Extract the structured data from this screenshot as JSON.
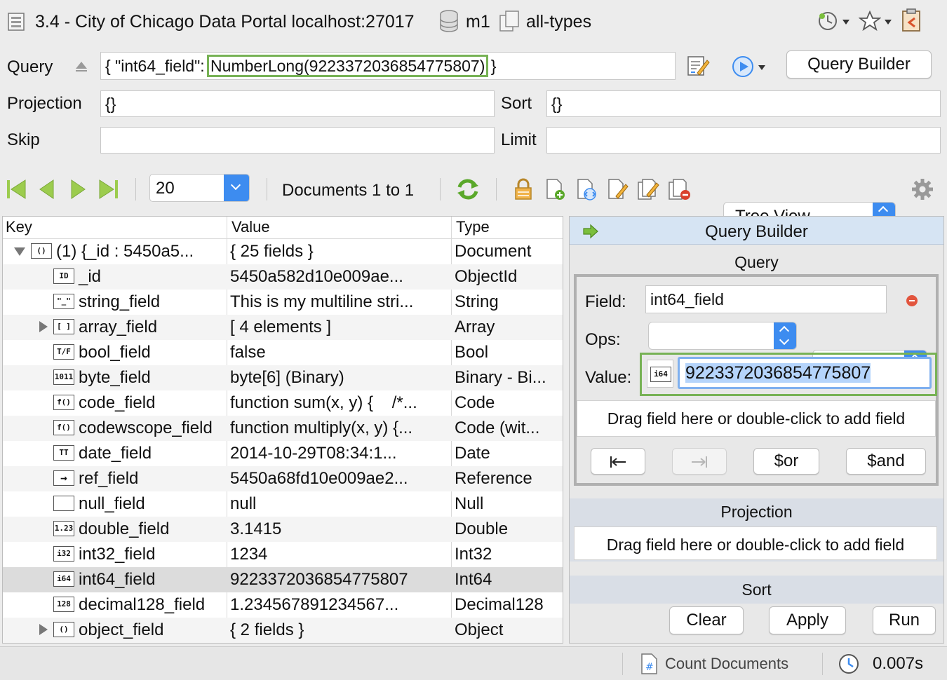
{
  "title": {
    "connection": "3.4 - City of Chicago Data Portal localhost:27017",
    "database": "m1",
    "collection": "all-types"
  },
  "query": {
    "label": "Query",
    "prefix": "{ \"int64_field\": ",
    "highlight": "NumberLong(9223372036854775807)",
    "suffix": "}",
    "builder_button": "Query Builder",
    "projection_label": "Projection",
    "projection_value": "{}",
    "sort_label": "Sort",
    "sort_value": "{}",
    "skip_label": "Skip",
    "skip_value": "",
    "limit_label": "Limit",
    "limit_value": ""
  },
  "toolbar": {
    "page_size": "20",
    "documents_label": "Documents 1 to 1",
    "view_mode": "Tree View"
  },
  "tree": {
    "headers": {
      "key": "Key",
      "value": "Value",
      "type": "Type"
    },
    "rows": [
      {
        "icon": "()",
        "key": "(1) {_id : 5450a5...",
        "value": "{ 25 fields }",
        "type": "Document"
      },
      {
        "icon": "ID",
        "key": "_id",
        "value": "5450a582d10e009ae...",
        "type": "ObjectId"
      },
      {
        "icon": "\"_\"",
        "key": "string_field",
        "value": "This is my multiline stri...",
        "type": "String"
      },
      {
        "icon": "[ ]",
        "key": "array_field",
        "value": "[ 4 elements ]",
        "type": "Array"
      },
      {
        "icon": "T/F",
        "key": "bool_field",
        "value": "false",
        "type": "Bool"
      },
      {
        "icon": "1011",
        "key": "byte_field",
        "value": "byte[6] (Binary)",
        "type": "Binary - Bi..."
      },
      {
        "icon": "f()",
        "key": "code_field",
        "value": "function sum(x, y) {    /*...",
        "type": "Code"
      },
      {
        "icon": "f()",
        "key": "codewscope_field",
        "value": "function multiply(x, y) {...",
        "type": "Code (wit..."
      },
      {
        "icon": "TT",
        "key": "date_field",
        "value": "2014-10-29T08:34:1...",
        "type": "Date"
      },
      {
        "icon": "→",
        "key": "ref_field",
        "value": "5450a68fd10e009ae2...",
        "type": "Reference"
      },
      {
        "icon": "",
        "key": "null_field",
        "value": "null",
        "type": "Null"
      },
      {
        "icon": "1.23",
        "key": "double_field",
        "value": "3.1415",
        "type": "Double"
      },
      {
        "icon": "i32",
        "key": "int32_field",
        "value": "1234",
        "type": "Int32"
      },
      {
        "icon": "i64",
        "key": "int64_field",
        "value": "9223372036854775807",
        "type": "Int64"
      },
      {
        "icon": "128",
        "key": "decimal128_field",
        "value": "1.234567891234567...",
        "type": "Decimal128"
      },
      {
        "icon": "()",
        "key": "object_field",
        "value": "{ 2 fields }",
        "type": "Object"
      }
    ]
  },
  "builder": {
    "header": "Query Builder",
    "query_section": "Query",
    "field_label": "Field:",
    "field_value": "int64_field",
    "ops_label": "Ops:",
    "ops_left_value": "",
    "ops_right_value": "==",
    "value_label": "Value:",
    "value_type_icon": "i64",
    "value_value": "9223372036854775807",
    "dropzone_text": "Drag field here or double-click to add field",
    "or_button": "$or",
    "and_button": "$and",
    "projection_section": "Projection",
    "projection_dropzone": "Drag field here or double-click to add field",
    "sort_section": "Sort",
    "clear_button": "Clear",
    "apply_button": "Apply",
    "run_button": "Run"
  },
  "status": {
    "count_label": "Count Documents",
    "time": "0.007s"
  },
  "colors": {
    "highlight_green": "#77b255",
    "accent_blue": "#3d8cf0",
    "nav_green": "#9ccc4e"
  }
}
